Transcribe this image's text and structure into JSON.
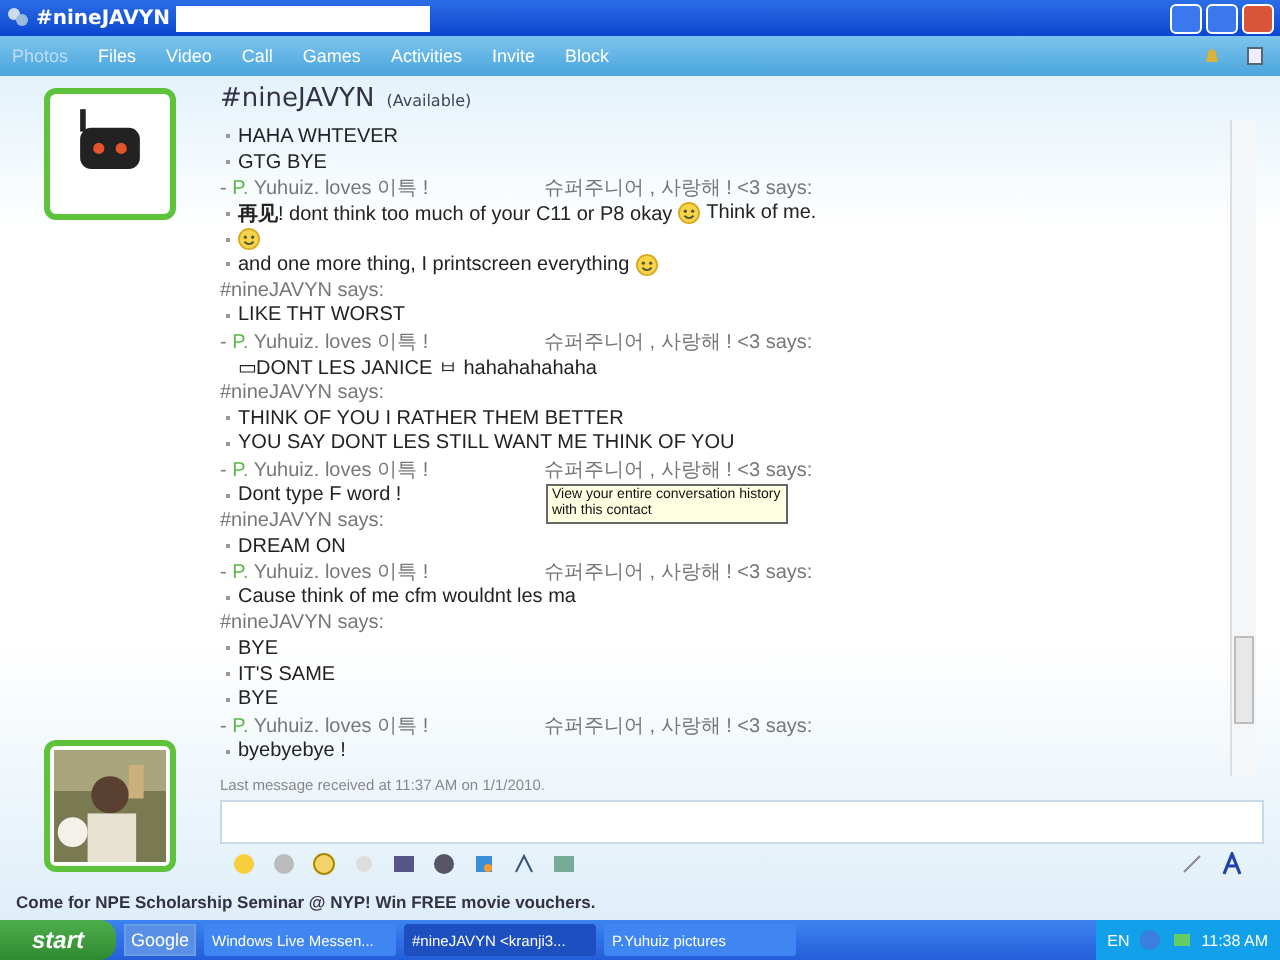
{
  "window": {
    "title": "#nineJAVYN"
  },
  "menu": [
    "Photos",
    "Files",
    "Video",
    "Call",
    "Games",
    "Activities",
    "Invite",
    "Block"
  ],
  "contact": {
    "name": "#nineJAVYN",
    "status": "(Available)"
  },
  "conversation": [
    {
      "kind": "message",
      "bullet": true,
      "parts": [
        {
          "kind": "text",
          "text": "HAHA WHTEVER"
        }
      ]
    },
    {
      "kind": "message",
      "bullet": true,
      "parts": [
        {
          "kind": "text",
          "text": "GTG BYE"
        }
      ]
    },
    {
      "kind": "sender",
      "lead": "-",
      "mark": "P.",
      "name": "Yuhuiz. loves 이특 !",
      "tagline": "슈퍼주니어 , 사랑해 ! <3 says:"
    },
    {
      "kind": "message",
      "bullet": true,
      "parts": [
        {
          "kind": "text",
          "text": "**再见**! dont think too much of your C11 or P8 okay"
        },
        {
          "kind": "emoticon"
        },
        {
          "kind": "text",
          "text": "Think of me."
        }
      ]
    },
    {
      "kind": "message",
      "bullet": true,
      "parts": [
        {
          "kind": "emoticon"
        }
      ]
    },
    {
      "kind": "message",
      "bullet": true,
      "parts": [
        {
          "kind": "text",
          "text": "and one more thing, I printscreen everything"
        },
        {
          "kind": "emoticon"
        }
      ]
    },
    {
      "kind": "header",
      "text": "#nineJAVYN says:"
    },
    {
      "kind": "message",
      "bullet": true,
      "parts": [
        {
          "kind": "text",
          "text": "LIKE THT WORST"
        }
      ]
    },
    {
      "kind": "sender",
      "lead": "-",
      "mark": "P.",
      "name": "Yuhuiz. loves 이특 !",
      "tagline": "슈퍼주니어 , 사랑해 ! <3 says:"
    },
    {
      "kind": "message",
      "bullet": false,
      "parts": [
        {
          "kind": "text",
          "text": "▭DONT LES JANICE ㅂ hahahahahaha"
        }
      ]
    },
    {
      "kind": "header",
      "text": "#nineJAVYN says:"
    },
    {
      "kind": "message",
      "bullet": true,
      "parts": [
        {
          "kind": "text",
          "text": "THINK OF YOU I RATHER THEM BETTER"
        }
      ]
    },
    {
      "kind": "message",
      "bullet": true,
      "parts": [
        {
          "kind": "text",
          "text": "YOU SAY DONT LES STILL WANT ME THINK OF YOU"
        }
      ]
    },
    {
      "kind": "sender",
      "lead": "-",
      "mark": "P.",
      "name": "Yuhuiz. loves 이특 !",
      "tagline": "슈퍼주니어 , 사랑해 ! <3 says:"
    },
    {
      "kind": "message",
      "bullet": true,
      "parts": [
        {
          "kind": "text",
          "text": "Dont type F word !"
        }
      ]
    },
    {
      "kind": "header",
      "text": "#nineJAVYN says:"
    },
    {
      "kind": "message",
      "bullet": true,
      "parts": [
        {
          "kind": "text",
          "text": "DREAM ON"
        }
      ]
    },
    {
      "kind": "sender",
      "lead": "-",
      "mark": "P.",
      "name": "Yuhuiz. loves 이특 !",
      "tagline": "슈퍼주니어 , 사랑해 ! <3 says:"
    },
    {
      "kind": "message",
      "bullet": true,
      "parts": [
        {
          "kind": "text",
          "text": "Cause think of me cfm wouldnt les ma"
        }
      ]
    },
    {
      "kind": "header",
      "text": "#nineJAVYN says:"
    },
    {
      "kind": "message",
      "bullet": true,
      "parts": [
        {
          "kind": "text",
          "text": "BYE"
        }
      ]
    },
    {
      "kind": "message",
      "bullet": true,
      "parts": [
        {
          "kind": "text",
          "text": "IT'S SAME"
        }
      ]
    },
    {
      "kind": "message",
      "bullet": true,
      "parts": [
        {
          "kind": "text",
          "text": "BYE"
        }
      ]
    },
    {
      "kind": "sender",
      "lead": "-",
      "mark": "P.",
      "name": "Yuhuiz. loves 이특 !",
      "tagline": "슈퍼주니어 , 사랑해 ! <3 says:"
    },
    {
      "kind": "message",
      "bullet": true,
      "parts": [
        {
          "kind": "text",
          "text": "byebyebye !"
        }
      ]
    }
  ],
  "last_message": "Last message received at 11:37 AM on 1/1/2010.",
  "tooltip": "View your entire conversation history with this contact",
  "ad": "Come for NPE Scholarship Seminar @ NYP! Win FREE movie vouchers.",
  "taskbar": {
    "start": "start",
    "google": "Google",
    "tasks": [
      {
        "label": "Windows Live Messen...",
        "selected": false
      },
      {
        "label": "#nineJAVYN <kranji3...",
        "selected": true
      },
      {
        "label": "P.Yuhuiz pictures",
        "selected": false
      }
    ],
    "lang": "EN",
    "clock": "11:38 AM"
  }
}
